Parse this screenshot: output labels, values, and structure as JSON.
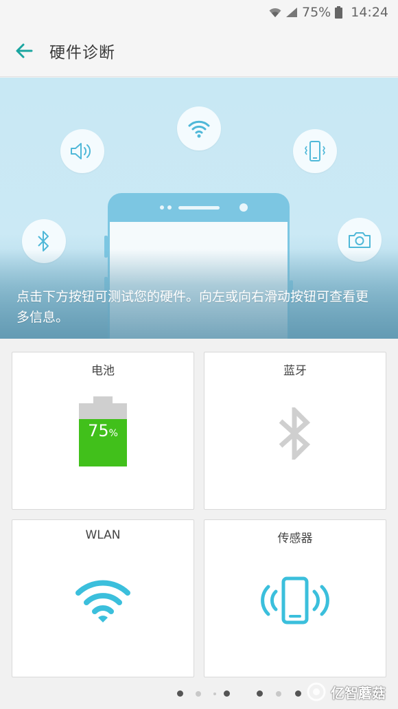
{
  "status_bar": {
    "battery_text": "75%",
    "time": "14:24",
    "icons": [
      "wifi-icon",
      "signal-icon",
      "battery-icon"
    ]
  },
  "app_bar": {
    "title": "硬件诊断",
    "back_icon": "arrow-left-icon"
  },
  "hero": {
    "caption": "点击下方按钮可测试您的硬件。向左或向右滑动按钮可查看更多信息。",
    "icons": [
      "wifi-icon",
      "speaker-icon",
      "vibration-icon",
      "bluetooth-icon",
      "camera-icon"
    ]
  },
  "cards": [
    {
      "label": "电池",
      "icon": "battery-icon",
      "battery_value": "75",
      "battery_unit": "%",
      "battery_level": 0.75
    },
    {
      "label": "蓝牙",
      "icon": "bluetooth-icon"
    },
    {
      "label": "WLAN",
      "icon": "wifi-icon"
    },
    {
      "label": "传感器",
      "icon": "sensor-phone-icon"
    }
  ],
  "pager": {
    "total": 7,
    "current": 0
  },
  "watermark": {
    "text": "亿智蘑菇"
  },
  "colors": {
    "accent": "#1aa5a0",
    "hero_bg": "#c8e8f4",
    "phone": "#7cc6e2",
    "battery_green": "#41c01b",
    "wifi_blue": "#3bbfdc",
    "bluetooth_gray": "#cfcfcf"
  }
}
